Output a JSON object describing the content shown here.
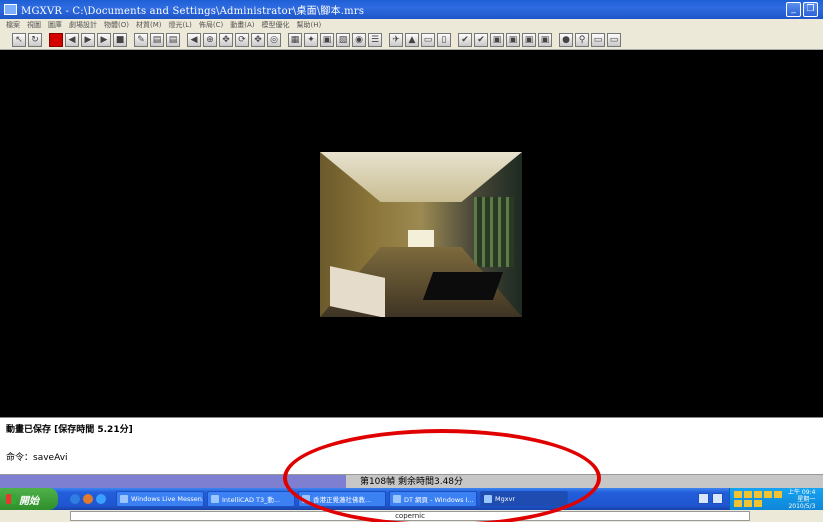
{
  "window": {
    "title": "MGXVR - C:\\Documents and Settings\\Administrator\\桌面\\腳本.mrs",
    "minimize": "_",
    "restore": "❐"
  },
  "menu": [
    "檔案",
    "視圖",
    "圖庫",
    "劇場設計",
    "物體(O)",
    "材質(M)",
    "燈光(L)",
    "佈局(C)",
    "動畫(A)",
    "模型優化",
    "幫助(H)"
  ],
  "toolbar_icons": [
    "select-icon",
    "rotate-icon",
    "record-icon",
    "rewind-icon",
    "play-icon",
    "forward-icon",
    "stop-icon",
    "paint-icon",
    "layer-icon",
    "layer2-icon",
    "back-icon",
    "zoom-icon",
    "move-icon",
    "orbit-icon",
    "pan-icon",
    "target-icon",
    "grid-icon",
    "light-icon",
    "object-icon",
    "material-icon",
    "camera-icon",
    "walk-icon",
    "fly-icon",
    "cone-icon",
    "plane-icon",
    "door-icon",
    "check-icon",
    "check2-icon",
    "box-icon",
    "box2-icon",
    "box3-icon",
    "box4-icon",
    "sphere-icon",
    "magnify-icon",
    "frame-icon",
    "frame2-icon"
  ],
  "console": {
    "line1": "動畫已保存 [保存時間 5.21分]",
    "line2": "命令：saveAvi"
  },
  "progress": {
    "text": "第108幀 剩余時間3.48分",
    "fraction": 0.42
  },
  "taskbar": {
    "start_label": "開始",
    "tasks": [
      {
        "label": "Windows Live Messen..."
      },
      {
        "label": "IntelliCAD T3_動..."
      },
      {
        "label": "香港正覺蓮社佛教..."
      },
      {
        "label": "DT 網頁 - Windows I..."
      },
      {
        "label": "Mgxvr"
      }
    ],
    "clock_time": "上午 09:4",
    "clock_day": "星期一",
    "clock_date": "2010/5/3"
  },
  "bottombar": {
    "field_text": "copernic"
  },
  "colors": {
    "progress_fill": "#7e7fd0",
    "annotation": "#e00000"
  }
}
